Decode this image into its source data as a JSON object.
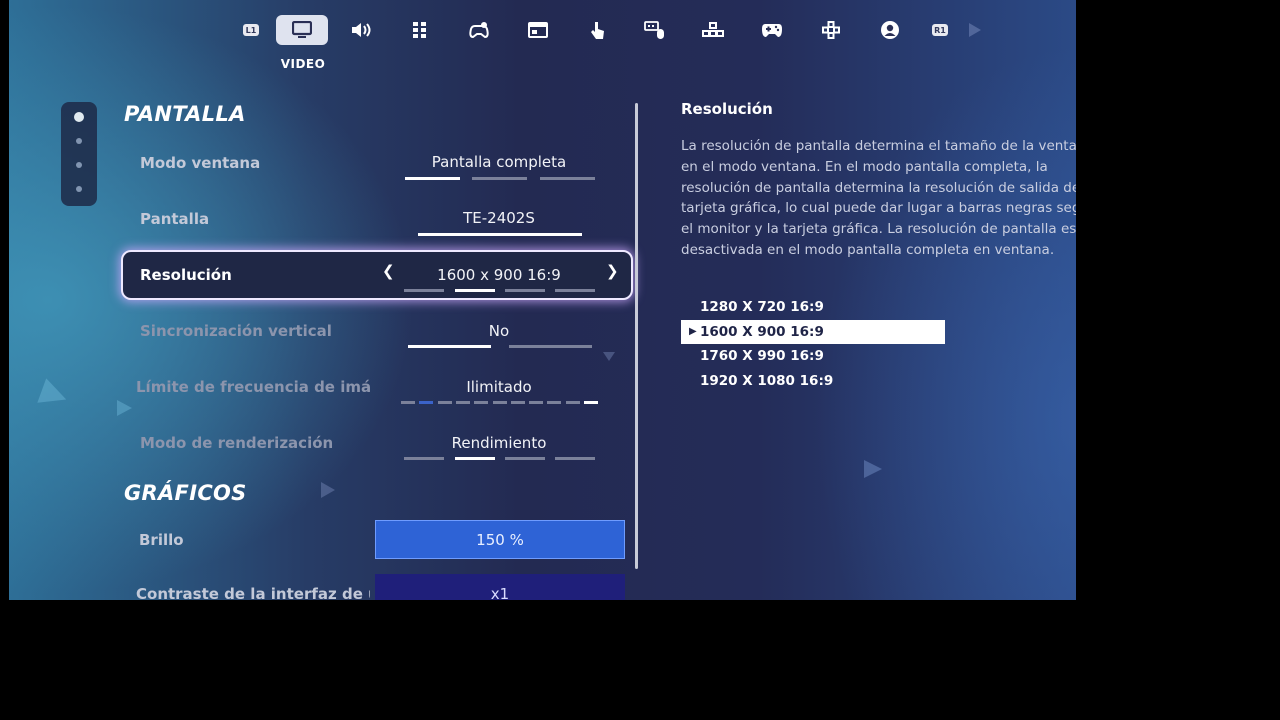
{
  "tabs": {
    "left_shoulder": "L1",
    "right_shoulder": "R1",
    "active_title": "VIDEO",
    "items": [
      {
        "name": "video",
        "icon": "monitor-icon",
        "active": true
      },
      {
        "name": "audio",
        "icon": "speaker-icon"
      },
      {
        "name": "accessibility",
        "icon": "grid-icon"
      },
      {
        "name": "controls",
        "icon": "gamepad-gear-icon"
      },
      {
        "name": "hud",
        "icon": "window-icon"
      },
      {
        "name": "touch",
        "icon": "touch-icon"
      },
      {
        "name": "keyboard-mouse",
        "icon": "keyboard-mouse-icon"
      },
      {
        "name": "build-controls",
        "icon": "build-icon"
      },
      {
        "name": "controller",
        "icon": "controller-icon"
      },
      {
        "name": "controller-binds",
        "icon": "dpad-icon"
      },
      {
        "name": "account",
        "icon": "account-icon"
      }
    ]
  },
  "sections": {
    "pantalla": "PANTALLA",
    "graficos": "GRÁFICOS"
  },
  "rows": {
    "modo_ventana": {
      "label": "Modo ventana",
      "value": "Pantalla completa",
      "selected_index": 0,
      "options_count": 3
    },
    "pantalla": {
      "label": "Pantalla",
      "value": "TE-2402S"
    },
    "resolucion": {
      "label": "Resolución",
      "value": "1600 x 900 16:9",
      "selected_index": 1,
      "options_count": 4
    },
    "vsync": {
      "label": "Sincronización vertical",
      "value": "No",
      "selected_index": 0,
      "options_count": 2
    },
    "fps_limit": {
      "label": "Límite de frecuencia de imág",
      "value": "Ilimitado",
      "options_count": 11
    },
    "render_mode": {
      "label": "Modo de renderización",
      "value": "Rendimiento",
      "selected_index": 1,
      "options_count": 4
    },
    "brillo": {
      "label": "Brillo",
      "value": "150 %"
    },
    "contraste": {
      "label": "Contraste de la interfaz de u",
      "value": "x1"
    }
  },
  "description": {
    "title": "Resolución",
    "text": "La resolución de pantalla determina el tamaño de la ventana en el modo ventana. En el modo pantalla completa, la resolución de pantalla determina la resolución de salida de la tarjeta gráfica, lo cual puede dar lugar a barras negras según el monitor y la tarjeta gráfica. La resolución de pantalla está desactivada en el modo pantalla completa en ventana."
  },
  "resolution_options": [
    "1280 X 720 16:9",
    "1600 X 900 16:9",
    "1760 X 990 16:9",
    "1920 X 1080 16:9"
  ],
  "selected_resolution": "1600 X 900 16:9",
  "colors": {
    "accent_blue": "#2e63d6",
    "highlight_glow": "#cdaaff",
    "panel_bg": "#232a52"
  }
}
